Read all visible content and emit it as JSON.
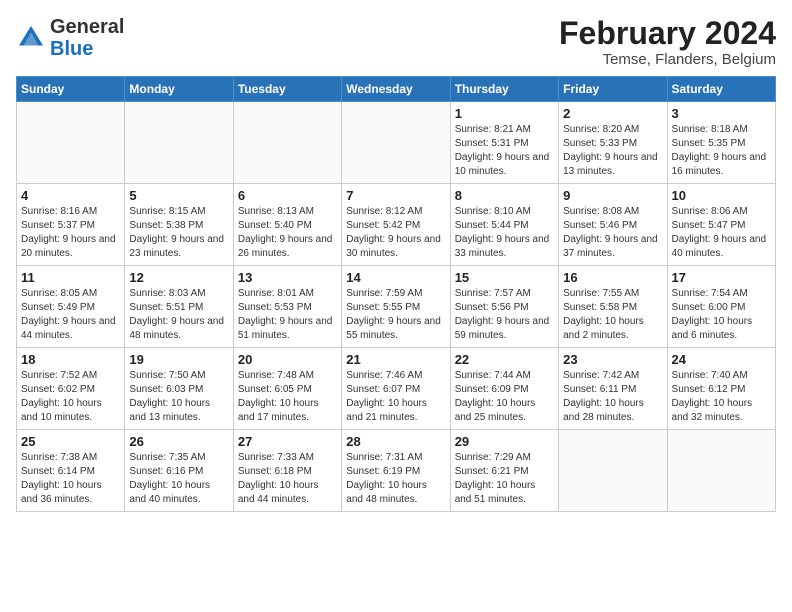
{
  "header": {
    "logo_general": "General",
    "logo_blue": "Blue",
    "title": "February 2024",
    "subtitle": "Temse, Flanders, Belgium"
  },
  "weekdays": [
    "Sunday",
    "Monday",
    "Tuesday",
    "Wednesday",
    "Thursday",
    "Friday",
    "Saturday"
  ],
  "weeks": [
    [
      {
        "day": "",
        "info": ""
      },
      {
        "day": "",
        "info": ""
      },
      {
        "day": "",
        "info": ""
      },
      {
        "day": "",
        "info": ""
      },
      {
        "day": "1",
        "info": "Sunrise: 8:21 AM\nSunset: 5:31 PM\nDaylight: 9 hours\nand 10 minutes."
      },
      {
        "day": "2",
        "info": "Sunrise: 8:20 AM\nSunset: 5:33 PM\nDaylight: 9 hours\nand 13 minutes."
      },
      {
        "day": "3",
        "info": "Sunrise: 8:18 AM\nSunset: 5:35 PM\nDaylight: 9 hours\nand 16 minutes."
      }
    ],
    [
      {
        "day": "4",
        "info": "Sunrise: 8:16 AM\nSunset: 5:37 PM\nDaylight: 9 hours\nand 20 minutes."
      },
      {
        "day": "5",
        "info": "Sunrise: 8:15 AM\nSunset: 5:38 PM\nDaylight: 9 hours\nand 23 minutes."
      },
      {
        "day": "6",
        "info": "Sunrise: 8:13 AM\nSunset: 5:40 PM\nDaylight: 9 hours\nand 26 minutes."
      },
      {
        "day": "7",
        "info": "Sunrise: 8:12 AM\nSunset: 5:42 PM\nDaylight: 9 hours\nand 30 minutes."
      },
      {
        "day": "8",
        "info": "Sunrise: 8:10 AM\nSunset: 5:44 PM\nDaylight: 9 hours\nand 33 minutes."
      },
      {
        "day": "9",
        "info": "Sunrise: 8:08 AM\nSunset: 5:46 PM\nDaylight: 9 hours\nand 37 minutes."
      },
      {
        "day": "10",
        "info": "Sunrise: 8:06 AM\nSunset: 5:47 PM\nDaylight: 9 hours\nand 40 minutes."
      }
    ],
    [
      {
        "day": "11",
        "info": "Sunrise: 8:05 AM\nSunset: 5:49 PM\nDaylight: 9 hours\nand 44 minutes."
      },
      {
        "day": "12",
        "info": "Sunrise: 8:03 AM\nSunset: 5:51 PM\nDaylight: 9 hours\nand 48 minutes."
      },
      {
        "day": "13",
        "info": "Sunrise: 8:01 AM\nSunset: 5:53 PM\nDaylight: 9 hours\nand 51 minutes."
      },
      {
        "day": "14",
        "info": "Sunrise: 7:59 AM\nSunset: 5:55 PM\nDaylight: 9 hours\nand 55 minutes."
      },
      {
        "day": "15",
        "info": "Sunrise: 7:57 AM\nSunset: 5:56 PM\nDaylight: 9 hours\nand 59 minutes."
      },
      {
        "day": "16",
        "info": "Sunrise: 7:55 AM\nSunset: 5:58 PM\nDaylight: 10 hours\nand 2 minutes."
      },
      {
        "day": "17",
        "info": "Sunrise: 7:54 AM\nSunset: 6:00 PM\nDaylight: 10 hours\nand 6 minutes."
      }
    ],
    [
      {
        "day": "18",
        "info": "Sunrise: 7:52 AM\nSunset: 6:02 PM\nDaylight: 10 hours\nand 10 minutes."
      },
      {
        "day": "19",
        "info": "Sunrise: 7:50 AM\nSunset: 6:03 PM\nDaylight: 10 hours\nand 13 minutes."
      },
      {
        "day": "20",
        "info": "Sunrise: 7:48 AM\nSunset: 6:05 PM\nDaylight: 10 hours\nand 17 minutes."
      },
      {
        "day": "21",
        "info": "Sunrise: 7:46 AM\nSunset: 6:07 PM\nDaylight: 10 hours\nand 21 minutes."
      },
      {
        "day": "22",
        "info": "Sunrise: 7:44 AM\nSunset: 6:09 PM\nDaylight: 10 hours\nand 25 minutes."
      },
      {
        "day": "23",
        "info": "Sunrise: 7:42 AM\nSunset: 6:11 PM\nDaylight: 10 hours\nand 28 minutes."
      },
      {
        "day": "24",
        "info": "Sunrise: 7:40 AM\nSunset: 6:12 PM\nDaylight: 10 hours\nand 32 minutes."
      }
    ],
    [
      {
        "day": "25",
        "info": "Sunrise: 7:38 AM\nSunset: 6:14 PM\nDaylight: 10 hours\nand 36 minutes."
      },
      {
        "day": "26",
        "info": "Sunrise: 7:35 AM\nSunset: 6:16 PM\nDaylight: 10 hours\nand 40 minutes."
      },
      {
        "day": "27",
        "info": "Sunrise: 7:33 AM\nSunset: 6:18 PM\nDaylight: 10 hours\nand 44 minutes."
      },
      {
        "day": "28",
        "info": "Sunrise: 7:31 AM\nSunset: 6:19 PM\nDaylight: 10 hours\nand 48 minutes."
      },
      {
        "day": "29",
        "info": "Sunrise: 7:29 AM\nSunset: 6:21 PM\nDaylight: 10 hours\nand 51 minutes."
      },
      {
        "day": "",
        "info": ""
      },
      {
        "day": "",
        "info": ""
      }
    ]
  ]
}
